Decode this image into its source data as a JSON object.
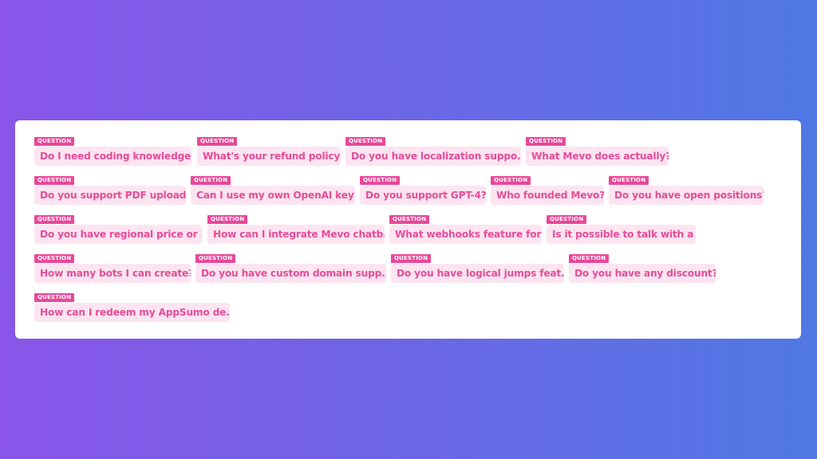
{
  "tag_label": "QUESTION",
  "colors": {
    "tag": "#e9479a",
    "chip_bg": "#fde4f1",
    "chip_text": "#e54d98"
  },
  "questions": [
    "Do I need coding knowledge?",
    "What's your refund policy?",
    "Do you have localization suppo...",
    "What Mevo does actually?",
    "Do you support PDF upload?",
    "Can I use my own OpenAI key?",
    "Do you support GPT-4?",
    "Who founded Mevo?",
    "Do you have open positions?",
    "Do you have regional price or ...",
    "How can I integrate Mevo chatb...",
    "What webhooks feature for?",
    "Is it possible to talk with a ...",
    "How many bots I can create?",
    "Do you have custom domain supp...",
    "Do you have logical jumps feat...",
    "Do you have any discount?",
    "How can I redeem my AppSumo de..."
  ]
}
